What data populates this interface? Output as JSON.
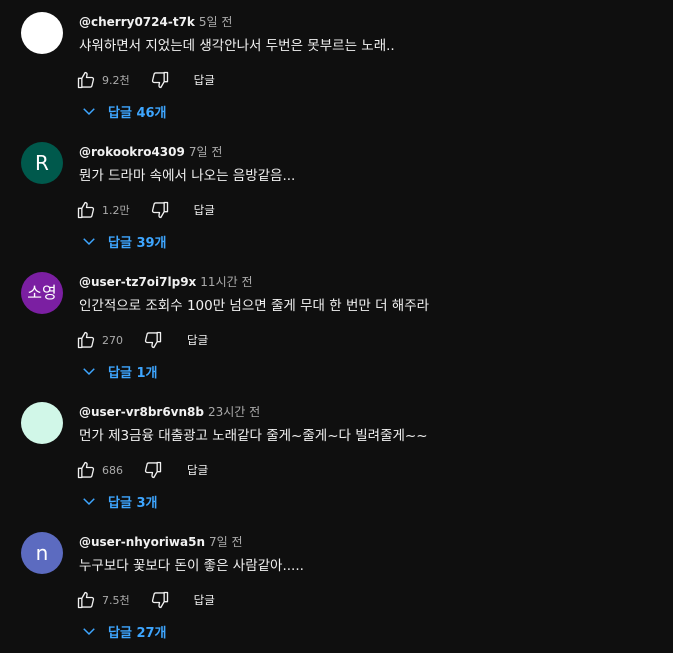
{
  "comments": [
    {
      "author": "@cherry0724-t7k",
      "time": "5일 전",
      "text": "샤워하면서 지었는데 생각안나서 두번은 못부르는 노래..",
      "likes": "9.2천",
      "reply_label": "답글",
      "replies_label": "답글 46개",
      "avatar_letter": "",
      "avatar_color": "#ffffff"
    },
    {
      "author": "@rokookro4309",
      "time": "7일 전",
      "text": "뭔가 드라마 속에서 나오는 음방같음...",
      "likes": "1.2만",
      "reply_label": "답글",
      "replies_label": "답글 39개",
      "avatar_letter": "R",
      "avatar_color": "#00594c"
    },
    {
      "author": "@user-tz7oi7lp9x",
      "time": "11시간 전",
      "text": "인간적으로 조회수 100만 넘으면 줄게 무대 한 번만 더 해주라",
      "likes": "270",
      "reply_label": "답글",
      "replies_label": "답글 1개",
      "avatar_letter": "소영",
      "avatar_color": "#7b1fa2"
    },
    {
      "author": "@user-vr8br6vn8b",
      "time": "23시간 전",
      "text": "먼가 제3금융 대출광고 노래같다 줄게~줄게~다 빌려줄게~~",
      "likes": "686",
      "reply_label": "답글",
      "replies_label": "답글 3개",
      "avatar_letter": "",
      "avatar_color": "#d1f7e8"
    },
    {
      "author": "@user-nhyoriwa5n",
      "time": "7일 전",
      "text": "누구보다 꽃보다 돈이 좋은 사람같아.....",
      "likes": "7.5천",
      "reply_label": "답글",
      "replies_label": "답글 27개",
      "avatar_letter": "n",
      "avatar_color": "#5c6bc0"
    }
  ],
  "colors": {
    "background": "#0f0f0f",
    "text_primary": "#f1f1f1",
    "text_secondary": "#aaaaaa",
    "link_blue": "#3ea6ff"
  },
  "icons": {
    "like": "thumbs-up-icon",
    "dislike": "thumbs-down-icon",
    "expand": "chevron-down-icon"
  }
}
